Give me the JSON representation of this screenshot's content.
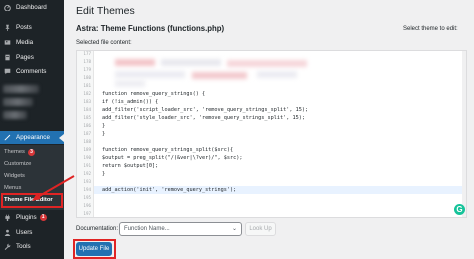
{
  "sidebar": {
    "items": [
      {
        "label": "Dashboard",
        "icon": "dashboard-icon"
      },
      {
        "label": "Posts",
        "icon": "pin-icon"
      },
      {
        "label": "Media",
        "icon": "media-icon"
      },
      {
        "label": "Pages",
        "icon": "page-icon"
      },
      {
        "label": "Comments",
        "icon": "comment-icon"
      },
      {
        "label": "Appearance",
        "icon": "brush-icon"
      },
      {
        "label": "Plugins",
        "icon": "plugin-icon",
        "badge": "1"
      },
      {
        "label": "Users",
        "icon": "user-icon"
      },
      {
        "label": "Tools",
        "icon": "wrench-icon"
      }
    ],
    "submenu": [
      {
        "label": "Themes",
        "badge": "3"
      },
      {
        "label": "Customize"
      },
      {
        "label": "Widgets"
      },
      {
        "label": "Menus"
      },
      {
        "label": "Theme File Editor"
      }
    ]
  },
  "main": {
    "page_title": "Edit Themes",
    "file_title": "Astra: Theme Functions (functions.php)",
    "select_label": "Select theme to edit:",
    "selected_file_label": "Selected file content:"
  },
  "editor": {
    "line_numbers": [
      "177",
      "178",
      "179",
      "180",
      "181",
      "182",
      "183",
      "184",
      "185",
      "186",
      "187",
      "188",
      "189",
      "190",
      "191",
      "192",
      "193",
      "194",
      "195",
      "196",
      "197",
      "198",
      "199",
      "200"
    ],
    "code_lines": [
      "",
      "",
      "",
      "",
      "",
      "function remove_query_strings() {",
      "if (!is_admin()) {",
      "add_filter('script_loader_src', 'remove_query_strings_split', 15);",
      "add_filter('style_loader_src', 'remove_query_strings_split', 15);",
      "}",
      "}",
      "",
      "function remove_query_strings_split($src){",
      "$output = preg_split(\"/(&ver|\\?ver)/\", $src);",
      "return $output[0];",
      "}",
      "",
      "add_action('init', 'remove_query_strings');",
      "",
      "",
      "",
      "",
      "",
      ""
    ]
  },
  "footer": {
    "documentation_label": "Documentation:",
    "function_placeholder": "Function Name...",
    "lookup_label": "Look Up",
    "update_label": "Update File"
  },
  "colors": {
    "sidebar_bg": "#1d2327",
    "accent": "#2271b1",
    "highlight_box": "#e02424",
    "badge": "#d63638"
  }
}
